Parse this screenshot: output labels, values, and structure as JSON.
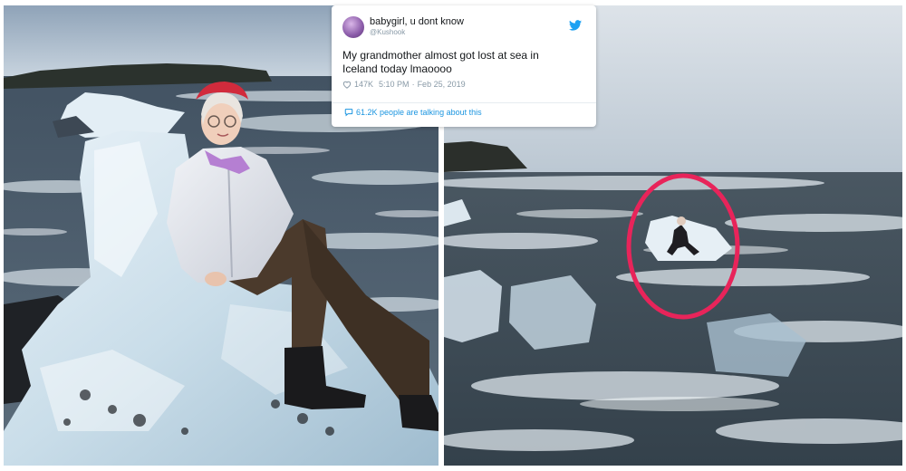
{
  "tweet": {
    "display_name": "babygirl, u dont know",
    "handle": "@Kushook",
    "text": "My grandmother almost got lost at sea in Iceland today lmaoooo",
    "likes": "147K",
    "time": "5:10 PM",
    "date": "Feb 25, 2019",
    "talking": "61.2K people are talking about this",
    "icons": {
      "like": "heart-icon",
      "reply": "speech-bubble-icon",
      "brand": "twitter-bird-icon"
    },
    "colors": {
      "link": "#1b95e0",
      "brand": "#1da1f2"
    }
  },
  "highlight": {
    "color": "#e8245a"
  }
}
